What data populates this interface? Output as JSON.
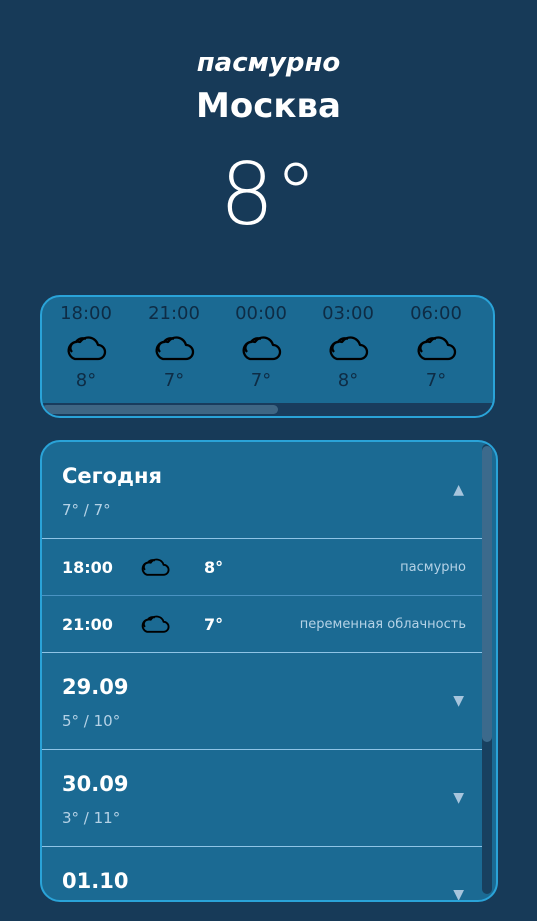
{
  "current": {
    "condition": "пасмурно",
    "city": "Москва",
    "temperature": "8°"
  },
  "hourly": [
    {
      "time": "18:00",
      "icon": "cloud-icon",
      "temp": "8°"
    },
    {
      "time": "21:00",
      "icon": "cloud-icon",
      "temp": "7°"
    },
    {
      "time": "00:00",
      "icon": "cloud-icon",
      "temp": "7°"
    },
    {
      "time": "03:00",
      "icon": "cloud-icon",
      "temp": "8°"
    },
    {
      "time": "06:00",
      "icon": "cloud-icon",
      "temp": "7°"
    }
  ],
  "days": [
    {
      "name": "Сегодня",
      "range": "7° / 7°",
      "expanded": true,
      "hours": [
        {
          "time": "18:00",
          "icon": "cloud-icon",
          "temp": "8°",
          "desc": "пасмурно"
        },
        {
          "time": "21:00",
          "icon": "cloud-icon",
          "temp": "7°",
          "desc": "переменная облачность"
        }
      ]
    },
    {
      "name": "29.09",
      "range": "5° / 10°",
      "expanded": false
    },
    {
      "name": "30.09",
      "range": "3° / 11°",
      "expanded": false
    },
    {
      "name": "01.10",
      "range": "",
      "expanded": false
    }
  ],
  "icons": {
    "expanded": "▲",
    "collapsed": "▼"
  },
  "colors": {
    "background": "#173a58",
    "panel": "#1b6a93",
    "border": "#2aa3d8"
  }
}
